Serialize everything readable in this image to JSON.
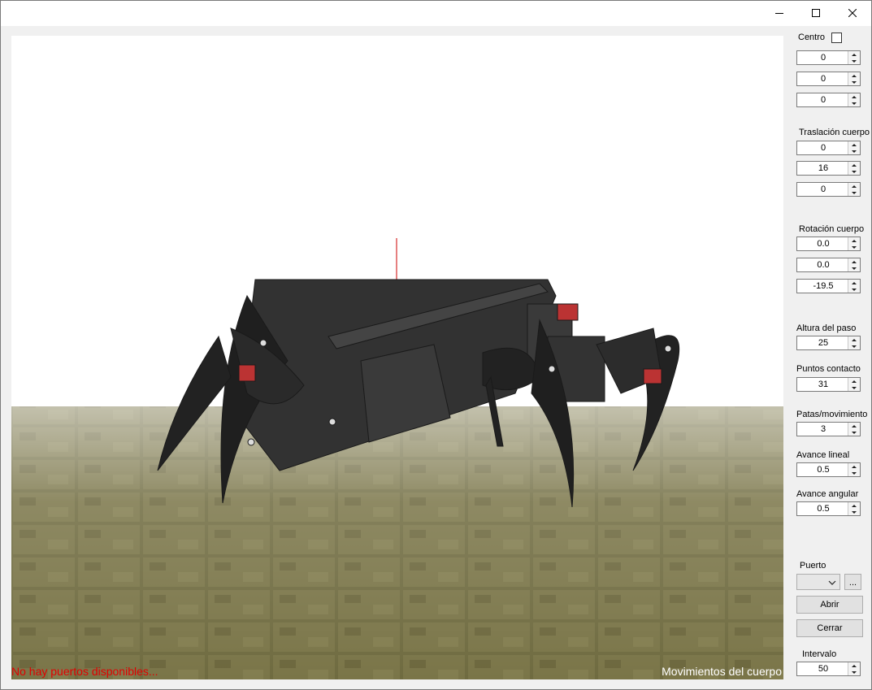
{
  "window": {
    "controls": [
      "minimize-icon",
      "maximize-icon",
      "close-icon"
    ]
  },
  "viewport": {
    "status_left": "No hay puertos disponibles...",
    "status_right": "Movimientos del cuerpo",
    "colors": {
      "sky": "#ffffff",
      "floor": "#6b6a3c",
      "robot": "#2b2b2b",
      "axis": "#cc0000"
    }
  },
  "panel": {
    "centro": {
      "label": "Centro",
      "checked": false,
      "values": [
        "0",
        "0",
        "0"
      ]
    },
    "traslacion": {
      "label": "Traslación cuerpo",
      "values": [
        "0",
        "16",
        "0"
      ]
    },
    "rotacion": {
      "label": "Rotación cuerpo",
      "values": [
        "0.0",
        "0.0",
        "-19.5"
      ]
    },
    "altura": {
      "label": "Altura del paso",
      "value": "25"
    },
    "puntos": {
      "label": "Puntos contacto",
      "value": "31"
    },
    "patas": {
      "label": "Patas/movimiento",
      "value": "3"
    },
    "avance_lineal": {
      "label": "Avance lineal",
      "value": "0.5"
    },
    "avance_angular": {
      "label": "Avance angular",
      "value": "0.5"
    },
    "puerto": {
      "label": "Puerto",
      "selected": "",
      "browse": "..."
    },
    "abrir": "Abrir",
    "cerrar": "Cerrar",
    "intervalo": {
      "label": "Intervalo",
      "value": "50"
    }
  }
}
